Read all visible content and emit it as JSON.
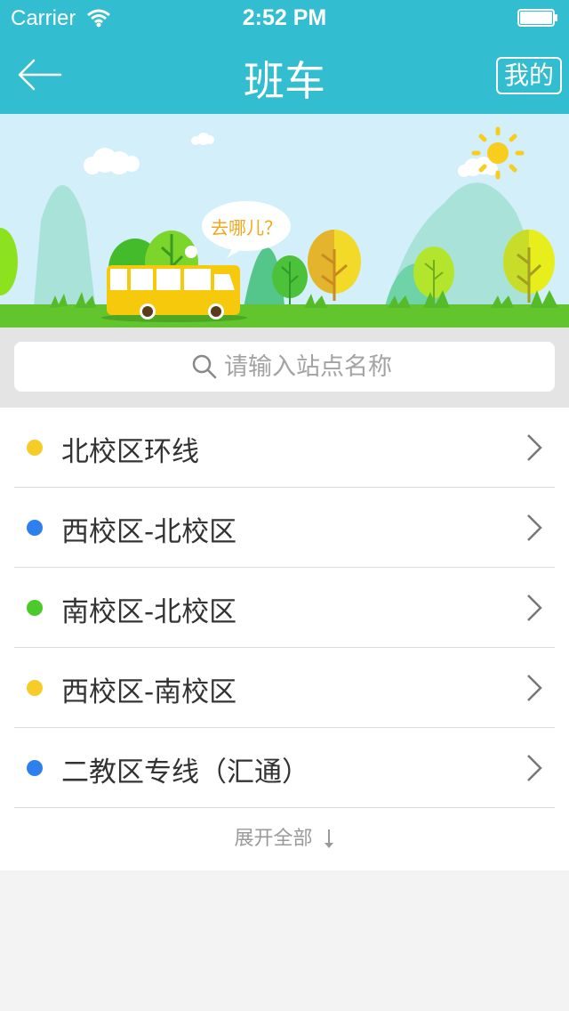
{
  "status_bar": {
    "carrier": "Carrier",
    "time": "2:52 PM"
  },
  "nav": {
    "title": "班车",
    "mine_label": "我的"
  },
  "banner": {
    "bubble_text": "去哪儿？"
  },
  "search": {
    "placeholder": "请输入站点名称"
  },
  "routes": [
    {
      "label": "北校区环线",
      "dot_color": "#f6cd28"
    },
    {
      "label": "西校区-北校区",
      "dot_color": "#2f80ed"
    },
    {
      "label": "南校区-北校区",
      "dot_color": "#4cca2c"
    },
    {
      "label": "西校区-南校区",
      "dot_color": "#f6cd28"
    },
    {
      "label": "二教区专线（汇通）",
      "dot_color": "#2f80ed"
    }
  ],
  "expand_label": "展开全部",
  "colors": {
    "header": "#33bdd0",
    "grass": "#62c52d",
    "sky": "#d2effa"
  }
}
